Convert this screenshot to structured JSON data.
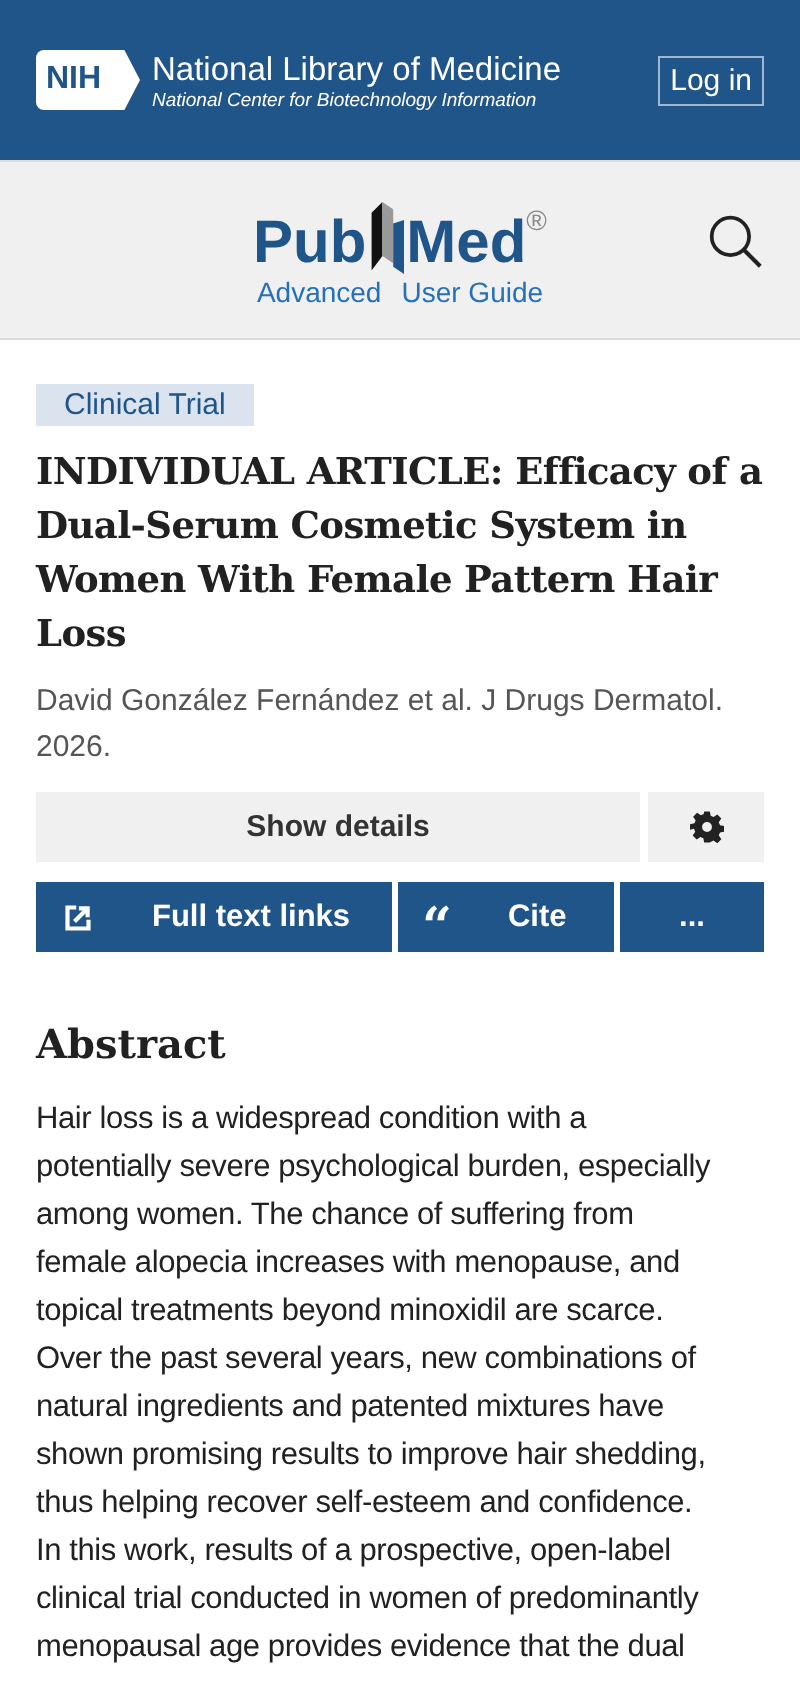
{
  "header": {
    "logo": "NIH",
    "title": "National Library of Medicine",
    "subtitle": "National Center for Biotechnology Information",
    "login": "Log in"
  },
  "brand": {
    "left": "Pub",
    "right": "Med",
    "mark": "®",
    "links": [
      "Advanced",
      "User Guide"
    ]
  },
  "article": {
    "tag": "Clinical Trial",
    "title": "INDIVIDUAL ARTICLE: Efficacy of a Dual-Serum Cosmetic System in Women With Female Pattern Hair Loss",
    "citation": "David González Fernández et al. J Drugs Dermatol. 2026."
  },
  "actions": {
    "details": "Show details",
    "buttons": [
      {
        "kind": "external",
        "label": "Full text links"
      },
      {
        "kind": "quote",
        "label": "Cite",
        "glyph": "“"
      },
      {
        "kind": "more",
        "label": "..."
      }
    ]
  },
  "abstract": {
    "heading": "Abstract",
    "lines": [
      "Hair loss is a widespread condition with a",
      "potentially severe psychological burden, especially",
      "among women. The chance of suffering from",
      "female alopecia increases with menopause, and",
      "topical treatments beyond minoxidil are scarce.",
      "Over the past several years, new combinations of",
      "natural ingredients and patented mixtures have",
      "shown promising results to improve hair shedding,",
      "thus helping recover self-esteem and confidence.",
      "In this work, results of a prospective, open-label",
      "clinical trial conducted in women of predominantly",
      "menopausal age provides evidence that the dual"
    ]
  }
}
